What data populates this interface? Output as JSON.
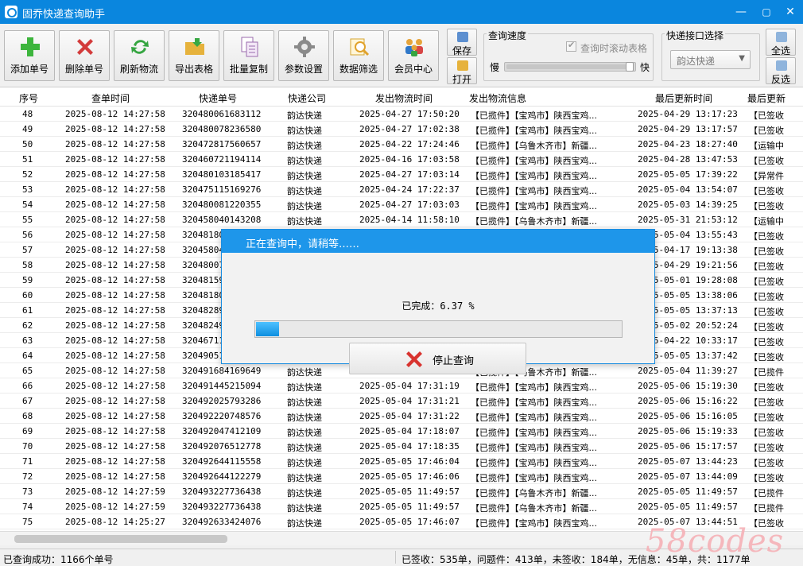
{
  "window": {
    "title": "固乔快递查询助手",
    "minimize": "—",
    "maximize": "▢",
    "close": "✕"
  },
  "toolbar": {
    "buttons": [
      {
        "label": "添加单号",
        "icon": "add-icon",
        "color": "#3db53d"
      },
      {
        "label": "删除单号",
        "icon": "delete-icon",
        "color": "#d33b3b"
      },
      {
        "label": "刷新物流",
        "icon": "refresh-icon",
        "color": "#35a541"
      },
      {
        "label": "导出表格",
        "icon": "export-folder-icon",
        "color": "#e6b23c"
      },
      {
        "label": "批量复制",
        "icon": "copy-icon",
        "color": "#b57ac3"
      },
      {
        "label": "参数设置",
        "icon": "gear-icon",
        "color": "#8a8a8a"
      },
      {
        "label": "数据筛选",
        "icon": "filter-search-icon",
        "color": "#e9b742"
      },
      {
        "label": "会员中心",
        "icon": "members-icon",
        "color": "#2f78c9"
      }
    ],
    "save_label": "保存",
    "open_label": "打开",
    "speed_group_label": "查询速度",
    "scroll_checkbox_label": "查询时滚动表格",
    "slow_label": "慢",
    "fast_label": "快",
    "interface_group_label": "快递接口选择",
    "interface_value": "韵达快递",
    "select_all_label": "全选",
    "invert_label": "反选"
  },
  "table": {
    "headers": [
      "序号",
      "查单时间",
      "快递单号",
      "快递公司",
      "发出物流时间",
      "发出物流信息",
      "最后更新时间",
      "最后更新"
    ],
    "rows": [
      [
        "48",
        "2025-08-12 14:27:58",
        "320480061683112",
        "韵达快递",
        "2025-04-27 17:50:20",
        "【已揽件】【宝鸡市】陕西宝鸡...",
        "2025-04-29 13:17:23",
        "【已签收"
      ],
      [
        "49",
        "2025-08-12 14:27:58",
        "320480078236580",
        "韵达快递",
        "2025-04-27 17:02:38",
        "【已揽件】【宝鸡市】陕西宝鸡...",
        "2025-04-29 13:17:57",
        "【已签收"
      ],
      [
        "50",
        "2025-08-12 14:27:58",
        "320472817560657",
        "韵达快递",
        "2025-04-22 17:24:46",
        "【已揽件】【乌鲁木齐市】新疆...",
        "2025-04-23 18:27:40",
        "【运输中"
      ],
      [
        "51",
        "2025-08-12 14:27:58",
        "320460721194114",
        "韵达快递",
        "2025-04-16 17:03:58",
        "【已揽件】【宝鸡市】陕西宝鸡...",
        "2025-04-28 13:47:53",
        "【已签收"
      ],
      [
        "52",
        "2025-08-12 14:27:58",
        "320480103185417",
        "韵达快递",
        "2025-04-27 17:03:14",
        "【已揽件】【宝鸡市】陕西宝鸡...",
        "2025-05-05 17:39:22",
        "【异常件"
      ],
      [
        "53",
        "2025-08-12 14:27:58",
        "320475115169276",
        "韵达快递",
        "2025-04-24 17:22:37",
        "【已揽件】【宝鸡市】陕西宝鸡...",
        "2025-05-04 13:54:07",
        "【已签收"
      ],
      [
        "54",
        "2025-08-12 14:27:58",
        "320480081220355",
        "韵达快递",
        "2025-04-27 17:03:03",
        "【已揽件】【宝鸡市】陕西宝鸡...",
        "2025-05-03 14:39:25",
        "【已签收"
      ],
      [
        "55",
        "2025-08-12 14:27:58",
        "320458040143208",
        "韵达快递",
        "2025-04-14 11:58:10",
        "【已揽件】【乌鲁木齐市】新疆...",
        "2025-05-31 21:53:12",
        "【运输中"
      ],
      [
        "56",
        "2025-08-12 14:27:58",
        "32048180",
        "",
        "",
        "",
        "2025-05-04 13:55:43",
        "【已签收"
      ],
      [
        "57",
        "2025-08-12 14:27:58",
        "32045804",
        "",
        "",
        "",
        "2025-04-17 19:13:38",
        "【已签收"
      ],
      [
        "58",
        "2025-08-12 14:27:58",
        "32048007",
        "",
        "",
        "",
        "2025-04-29 19:21:56",
        "【已签收"
      ],
      [
        "59",
        "2025-08-12 14:27:58",
        "32048159",
        "",
        "",
        "",
        "2025-05-01 19:28:08",
        "【已签收"
      ],
      [
        "60",
        "2025-08-12 14:27:58",
        "32048180",
        "",
        "",
        "",
        "2025-05-05 13:38:06",
        "【已签收"
      ],
      [
        "61",
        "2025-08-12 14:27:58",
        "32048289",
        "",
        "",
        "",
        "2025-05-05 13:37:13",
        "【已签收"
      ],
      [
        "62",
        "2025-08-12 14:27:58",
        "32048249",
        "",
        "",
        "",
        "2025-05-02 20:52:24",
        "【已签收"
      ],
      [
        "63",
        "2025-08-12 14:27:58",
        "32046711",
        "",
        "",
        "",
        "2025-04-22 10:33:17",
        "【已签收"
      ],
      [
        "64",
        "2025-08-12 14:27:58",
        "32049051",
        "",
        "",
        "",
        "2025-05-05 13:37:42",
        "【已签收"
      ],
      [
        "65",
        "2025-08-12 14:27:58",
        "320491684169649",
        "韵达快递",
        "2025-05-04 11:38:27",
        "【已揽件】【乌鲁木齐市】新疆...",
        "2025-05-04 11:39:27",
        "【已揽件"
      ],
      [
        "66",
        "2025-08-12 14:27:58",
        "320491445215094",
        "韵达快递",
        "2025-05-04 17:31:19",
        "【已揽件】【宝鸡市】陕西宝鸡...",
        "2025-05-06 15:19:30",
        "【已签收"
      ],
      [
        "67",
        "2025-08-12 14:27:58",
        "320492025793286",
        "韵达快递",
        "2025-05-04 17:31:21",
        "【已揽件】【宝鸡市】陕西宝鸡...",
        "2025-05-06 15:16:22",
        "【已签收"
      ],
      [
        "68",
        "2025-08-12 14:27:58",
        "320492220748576",
        "韵达快递",
        "2025-05-04 17:31:22",
        "【已揽件】【宝鸡市】陕西宝鸡...",
        "2025-05-06 15:16:05",
        "【已签收"
      ],
      [
        "69",
        "2025-08-12 14:27:58",
        "320492047412109",
        "韵达快递",
        "2025-05-04 17:18:07",
        "【已揽件】【宝鸡市】陕西宝鸡...",
        "2025-05-06 15:19:33",
        "【已签收"
      ],
      [
        "70",
        "2025-08-12 14:27:58",
        "320492076512778",
        "韵达快递",
        "2025-05-04 17:18:35",
        "【已揽件】【宝鸡市】陕西宝鸡...",
        "2025-05-06 15:17:57",
        "【已签收"
      ],
      [
        "71",
        "2025-08-12 14:27:58",
        "320492644115558",
        "韵达快递",
        "2025-05-05 17:46:04",
        "【已揽件】【宝鸡市】陕西宝鸡...",
        "2025-05-07 13:44:23",
        "【已签收"
      ],
      [
        "72",
        "2025-08-12 14:27:58",
        "320492644122279",
        "韵达快递",
        "2025-05-05 17:46:06",
        "【已揽件】【宝鸡市】陕西宝鸡...",
        "2025-05-07 13:44:09",
        "【已签收"
      ],
      [
        "73",
        "2025-08-12 14:27:59",
        "320493227736438",
        "韵达快递",
        "2025-05-05 11:49:57",
        "【已揽件】【乌鲁木齐市】新疆...",
        "2025-05-05 11:49:57",
        "【已揽件"
      ],
      [
        "74",
        "2025-08-12 14:27:59",
        "320493227736438",
        "韵达快递",
        "2025-05-05 11:49:57",
        "【已揽件】【乌鲁木齐市】新疆...",
        "2025-05-05 11:49:57",
        "【已揽件"
      ],
      [
        "75",
        "2025-08-12 14:25:27",
        "320492633424076",
        "韵达快递",
        "2025-05-05 17:46:07",
        "【已揽件】【宝鸡市】陕西宝鸡...",
        "2025-05-07 13:44:51",
        "【已签收"
      ]
    ]
  },
  "dialog": {
    "title": "正在查询中，请稍等……",
    "progress_text": "已完成：6.37 %",
    "progress_fraction": 0.0637,
    "stop_label": "停止查询"
  },
  "status": {
    "left": "已查询成功：1166个单号",
    "right": "已签收：535单，问题件：413单，未签收：184单，无信息：45单，共：1177单"
  },
  "watermark": "58codes"
}
